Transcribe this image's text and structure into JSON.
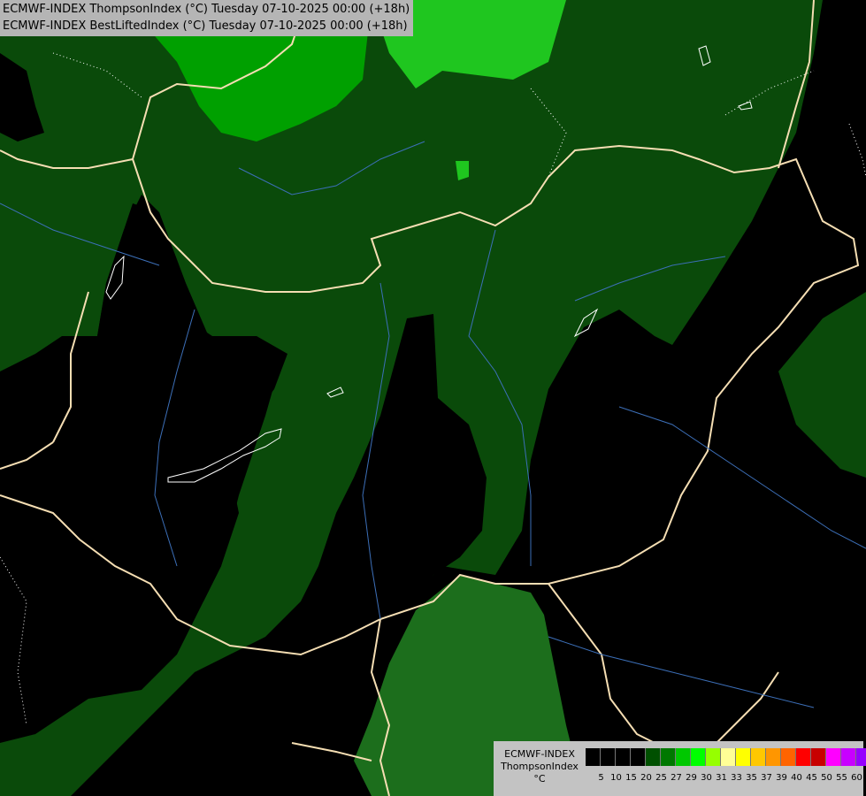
{
  "header": {
    "line1": "ECMWF-INDEX ThompsonIndex (°C) Tuesday 07-10-2025 00:00 (+18h)",
    "line2": "ECMWF-INDEX BestLiftedIndex (°C) Tuesday 07-10-2025 00:00 (+18h)"
  },
  "legend": {
    "model": "ECMWF-INDEX",
    "parameter": "ThompsonIndex",
    "unit": "°C",
    "colors": [
      "#000000",
      "#000000",
      "#000000",
      "#000000",
      "#005000",
      "#007800",
      "#00c800",
      "#00ff00",
      "#96ff00",
      "#ffff96",
      "#ffff00",
      "#ffc800",
      "#ff9600",
      "#ff6400",
      "#ff0000",
      "#c80000",
      "#ff00ff",
      "#c800ff",
      "#9600ff",
      "#6400ff",
      "#0000ff"
    ],
    "ticks": [
      "5",
      "10",
      "15",
      "20",
      "25",
      "27",
      "29",
      "30",
      "31",
      "33",
      "35",
      "37",
      "39",
      "40",
      "45",
      "50",
      "55",
      "60"
    ]
  },
  "map": {
    "colors": {
      "dark_green": "#0a4a0a",
      "mid_green": "#1f7a1f",
      "light_green": "#00aa00",
      "bright_green": "#22cc22",
      "black": "#000000",
      "border": "#f5deb3",
      "river": "#3c6fb8"
    }
  }
}
